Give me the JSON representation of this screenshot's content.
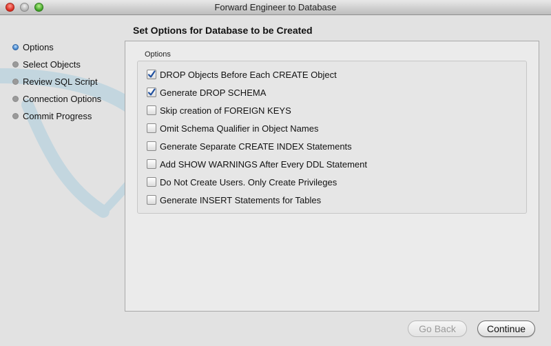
{
  "window": {
    "title": "Forward Engineer to Database"
  },
  "sidebar": {
    "steps": [
      {
        "label": "Options",
        "active": true
      },
      {
        "label": "Select Objects",
        "active": false
      },
      {
        "label": "Review SQL Script",
        "active": false
      },
      {
        "label": "Connection Options",
        "active": false
      },
      {
        "label": "Commit Progress",
        "active": false
      }
    ]
  },
  "main": {
    "header": "Set Options for Database to be Created",
    "group_label": "Options",
    "options": [
      {
        "label": "DROP Objects Before Each CREATE Object",
        "checked": true
      },
      {
        "label": "Generate DROP SCHEMA",
        "checked": true
      },
      {
        "label": "Skip creation of FOREIGN KEYS",
        "checked": false
      },
      {
        "label": "Omit Schema Qualifier in Object Names",
        "checked": false
      },
      {
        "label": "Generate Separate CREATE INDEX Statements",
        "checked": false
      },
      {
        "label": "Add SHOW WARNINGS After Every DDL Statement",
        "checked": false
      },
      {
        "label": "Do Not Create Users. Only Create Privileges",
        "checked": false
      },
      {
        "label": "Generate INSERT Statements for Tables",
        "checked": false
      }
    ]
  },
  "buttons": {
    "back": "Go Back",
    "continue": "Continue",
    "back_enabled": false
  },
  "colors": {
    "accent": "#3b7fc8",
    "check": "#1f4f9e"
  },
  "icons": {
    "watermark": "dolphin-icon"
  }
}
